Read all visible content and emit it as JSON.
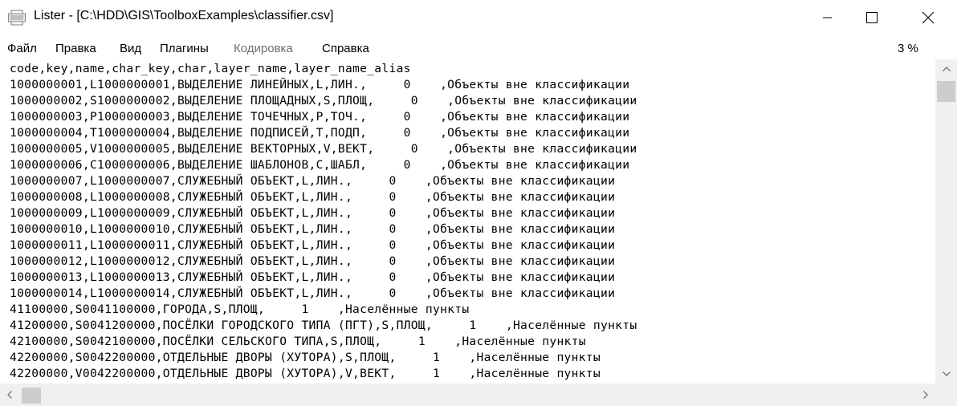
{
  "window": {
    "title": "Lister - [C:\\HDD\\GIS\\ToolboxExamples\\classifier.csv]"
  },
  "menu": {
    "items": [
      {
        "label": "Файл",
        "enabled": true
      },
      {
        "label": "Правка",
        "enabled": true
      },
      {
        "label": "Вид",
        "enabled": true
      },
      {
        "label": "Плагины",
        "enabled": true
      },
      {
        "label": "Кодировка",
        "enabled": false
      },
      {
        "label": "Справка",
        "enabled": true
      }
    ],
    "zoom": "3 %"
  },
  "content": {
    "lines": [
      "code,key,name,char_key,char,layer_name,layer_name_alias",
      "1000000001,L1000000001,ВЫДЕЛЕНИЕ ЛИНЕЙНЫХ,L,ЛИН.,     0    ,Объекты вне классификации",
      "1000000002,S1000000002,ВЫДЕЛЕНИЕ ПЛОЩАДНЫХ,S,ПЛОЩ,     0    ,Объекты вне классификации",
      "1000000003,P1000000003,ВЫДЕЛЕНИЕ ТОЧЕЧНЫХ,P,ТОЧ.,     0    ,Объекты вне классификации",
      "1000000004,T1000000004,ВЫДЕЛЕНИЕ ПОДПИСЕЙ,T,ПОДП,     0    ,Объекты вне классификации",
      "1000000005,V1000000005,ВЫДЕЛЕНИЕ ВЕКТОРНЫХ,V,ВЕКТ,     0    ,Объекты вне классификации",
      "1000000006,C1000000006,ВЫДЕЛЕНИЕ ШАБЛОНОВ,C,ШАБЛ,     0    ,Объекты вне классификации",
      "1000000007,L1000000007,СЛУЖЕБНЫЙ ОБЪЕКТ,L,ЛИН.,     0    ,Объекты вне классификации",
      "1000000008,L1000000008,СЛУЖЕБНЫЙ ОБЪЕКТ,L,ЛИН.,     0    ,Объекты вне классификации",
      "1000000009,L1000000009,СЛУЖЕБНЫЙ ОБЪЕКТ,L,ЛИН.,     0    ,Объекты вне классификации",
      "1000000010,L1000000010,СЛУЖЕБНЫЙ ОБЪЕКТ,L,ЛИН.,     0    ,Объекты вне классификации",
      "1000000011,L1000000011,СЛУЖЕБНЫЙ ОБЪЕКТ,L,ЛИН.,     0    ,Объекты вне классификации",
      "1000000012,L1000000012,СЛУЖЕБНЫЙ ОБЪЕКТ,L,ЛИН.,     0    ,Объекты вне классификации",
      "1000000013,L1000000013,СЛУЖЕБНЫЙ ОБЪЕКТ,L,ЛИН.,     0    ,Объекты вне классификации",
      "1000000014,L1000000014,СЛУЖЕБНЫЙ ОБЪЕКТ,L,ЛИН.,     0    ,Объекты вне классификации",
      "41100000,S0041100000,ГОРОДА,S,ПЛОЩ,     1    ,Населённые пункты",
      "41200000,S0041200000,ПОСЁЛКИ ГОРОДСКОГО ТИПА (ПГТ),S,ПЛОЩ,     1    ,Населённые пункты",
      "42100000,S0042100000,ПОСЁЛКИ СЕЛЬСКОГО ТИПА,S,ПЛОЩ,     1    ,Населённые пункты",
      "42200000,S0042200000,ОТДЕЛЬНЫЕ ДВОРЫ (ХУТОРА),S,ПЛОЩ,     1    ,Населённые пункты",
      "42200000,V0042200000,ОТДЕЛЬНЫЕ ДВОРЫ (ХУТОРА),V,ВЕКТ,     1    ,Населённые пункты"
    ]
  },
  "icons": {
    "app": "lister-document-icon",
    "minimize": "minimize-icon",
    "maximize": "maximize-icon",
    "close": "close-icon"
  }
}
